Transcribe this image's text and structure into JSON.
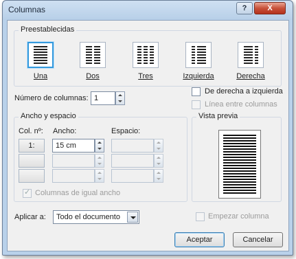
{
  "window": {
    "title": "Columnas",
    "help_label": "?",
    "close_label": "X"
  },
  "presets": {
    "label": "Preestablecidas",
    "items": [
      {
        "label": "Una",
        "selected": true
      },
      {
        "label": "Dos",
        "selected": false
      },
      {
        "label": "Tres",
        "selected": false
      },
      {
        "label": "Izquierda",
        "selected": false
      },
      {
        "label": "Derecha",
        "selected": false
      }
    ]
  },
  "num_columns": {
    "label": "Número de columnas:",
    "value": "1"
  },
  "right_to_left": {
    "label": "De derecha a izquierda",
    "checked": false
  },
  "line_between": {
    "label": "Línea entre columnas",
    "checked": false,
    "enabled": false
  },
  "width_spacing": {
    "label": "Ancho y espacio",
    "col_header": "Col. nº:",
    "width_header": "Ancho:",
    "spacing_header": "Espacio:",
    "rows": [
      {
        "col": "1:",
        "width": "15 cm",
        "spacing": ""
      },
      {
        "col": "",
        "width": "",
        "spacing": ""
      },
      {
        "col": "",
        "width": "",
        "spacing": ""
      }
    ],
    "equal_width_label": "Columnas de igual ancho",
    "equal_width_checked": true
  },
  "preview": {
    "label": "Vista previa"
  },
  "apply_to": {
    "label": "Aplicar a:",
    "value": "Todo el documento"
  },
  "start_column": {
    "label": "Empezar columna",
    "checked": false
  },
  "buttons": {
    "ok": "Aceptar",
    "cancel": "Cancelar"
  }
}
